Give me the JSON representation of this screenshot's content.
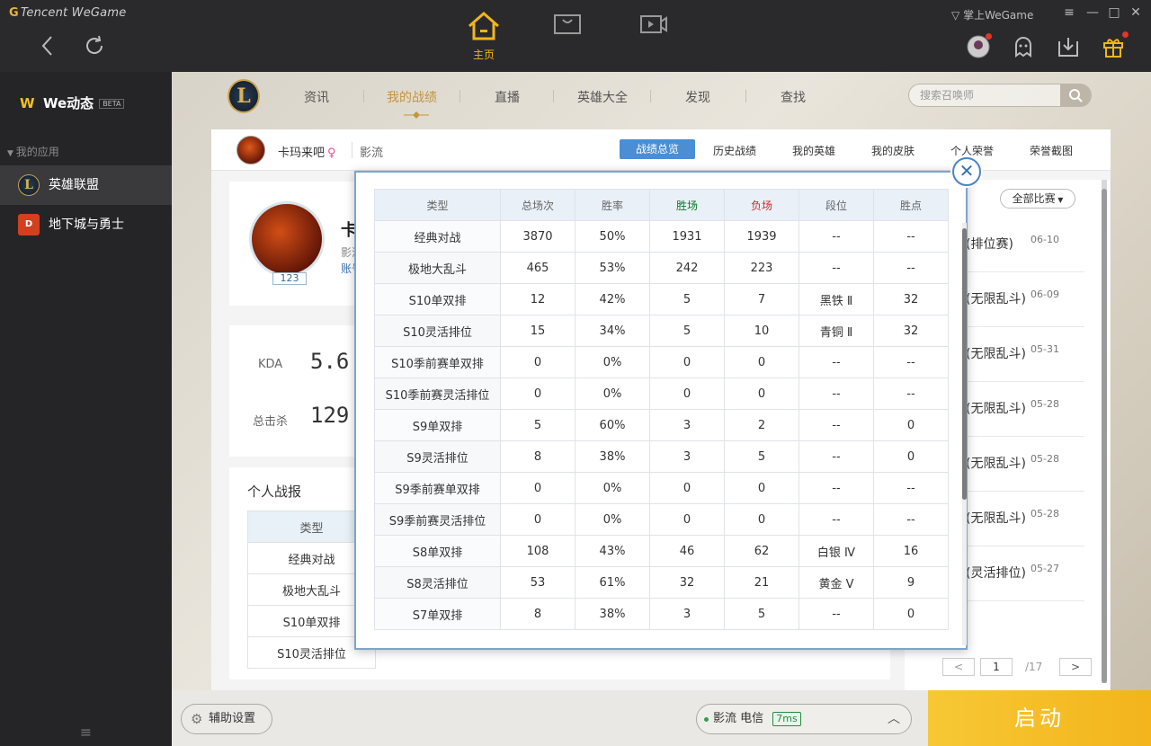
{
  "app": {
    "brand_g": "G",
    "brand": "Tencent WeGame",
    "home_label": "主页",
    "mobile_wegame": "掌上WeGame"
  },
  "sidebar": {
    "title": "We动态",
    "beta": "BETA",
    "section": "我的应用",
    "items": [
      {
        "label": "英雄联盟",
        "icon": "lol-app-icon"
      },
      {
        "label": "地下城与勇士",
        "icon": "dnf-app-icon"
      }
    ]
  },
  "lol_nav": {
    "logo_letter": "L",
    "items": [
      "资讯",
      "我的战绩",
      "直播",
      "英雄大全",
      "发现",
      "查找"
    ],
    "active": "我的战绩",
    "search_placeholder": "搜索召唤师"
  },
  "profile": {
    "name": "卡玛来吧",
    "gender_icon": "♀",
    "server": "影流",
    "tabs": [
      "战绩总览",
      "历史战绩",
      "我的英雄",
      "我的皮肤",
      "个人荣誉",
      "荣誉截图"
    ],
    "active_tab": "战绩总览",
    "level": "123",
    "name_initial": "卡",
    "sub_server": "影流",
    "account_link": "账号"
  },
  "stats": {
    "kda_label": "KDA",
    "kda_value": "5.6",
    "kills_label": "总击杀",
    "kills_value": "129"
  },
  "personal_report": {
    "title": "个人战报",
    "header": "类型",
    "rows": [
      "经典对战",
      "极地大乱斗",
      "S10单双排",
      "S10灵活排位"
    ]
  },
  "recent": {
    "filter": "全部比赛",
    "rows": [
      {
        "mode": "(排位赛)",
        "date": "06-10"
      },
      {
        "mode": "(无限乱斗)",
        "date": "06-09"
      },
      {
        "mode": "(无限乱斗)",
        "date": "05-31"
      },
      {
        "mode": "(无限乱斗)",
        "date": "05-28"
      },
      {
        "mode": "(无限乱斗)",
        "date": "05-28"
      },
      {
        "mode": "(无限乱斗)",
        "date": "05-28"
      },
      {
        "mode": "(灵活排位)",
        "date": "05-27"
      }
    ],
    "page": "1",
    "total_pages": "/17"
  },
  "modal": {
    "headers": [
      "类型",
      "总场次",
      "胜率",
      "胜场",
      "负场",
      "段位",
      "胜点"
    ],
    "rows": [
      [
        "经典对战",
        "3870",
        "50%",
        "1931",
        "1939",
        "--",
        "--"
      ],
      [
        "极地大乱斗",
        "465",
        "53%",
        "242",
        "223",
        "--",
        "--"
      ],
      [
        "S10单双排",
        "12",
        "42%",
        "5",
        "7",
        "黑铁 Ⅱ",
        "32"
      ],
      [
        "S10灵活排位",
        "15",
        "34%",
        "5",
        "10",
        "青铜 Ⅱ",
        "32"
      ],
      [
        "S10季前赛单双排",
        "0",
        "0%",
        "0",
        "0",
        "--",
        "--"
      ],
      [
        "S10季前赛灵活排位",
        "0",
        "0%",
        "0",
        "0",
        "--",
        "--"
      ],
      [
        "S9单双排",
        "5",
        "60%",
        "3",
        "2",
        "--",
        "0"
      ],
      [
        "S9灵活排位",
        "8",
        "38%",
        "3",
        "5",
        "--",
        "0"
      ],
      [
        "S9季前赛单双排",
        "0",
        "0%",
        "0",
        "0",
        "--",
        "--"
      ],
      [
        "S9季前赛灵活排位",
        "0",
        "0%",
        "0",
        "0",
        "--",
        "--"
      ],
      [
        "S8单双排",
        "108",
        "43%",
        "46",
        "62",
        "白银 Ⅳ",
        "16"
      ],
      [
        "S8灵活排位",
        "53",
        "61%",
        "32",
        "21",
        "黄金 Ⅴ",
        "9"
      ],
      [
        "S7单双排",
        "8",
        "38%",
        "3",
        "5",
        "--",
        "0"
      ]
    ],
    "close_icon": "✕"
  },
  "bottom": {
    "assist": "辅助设置",
    "server_name": "影流 电信",
    "ping": "7ms",
    "launch": "启动"
  },
  "colors": {
    "accent": "#f3b41c",
    "win": "#0a7a2a",
    "loss": "#d22a2a",
    "active_tab": "#4a8ed3"
  }
}
